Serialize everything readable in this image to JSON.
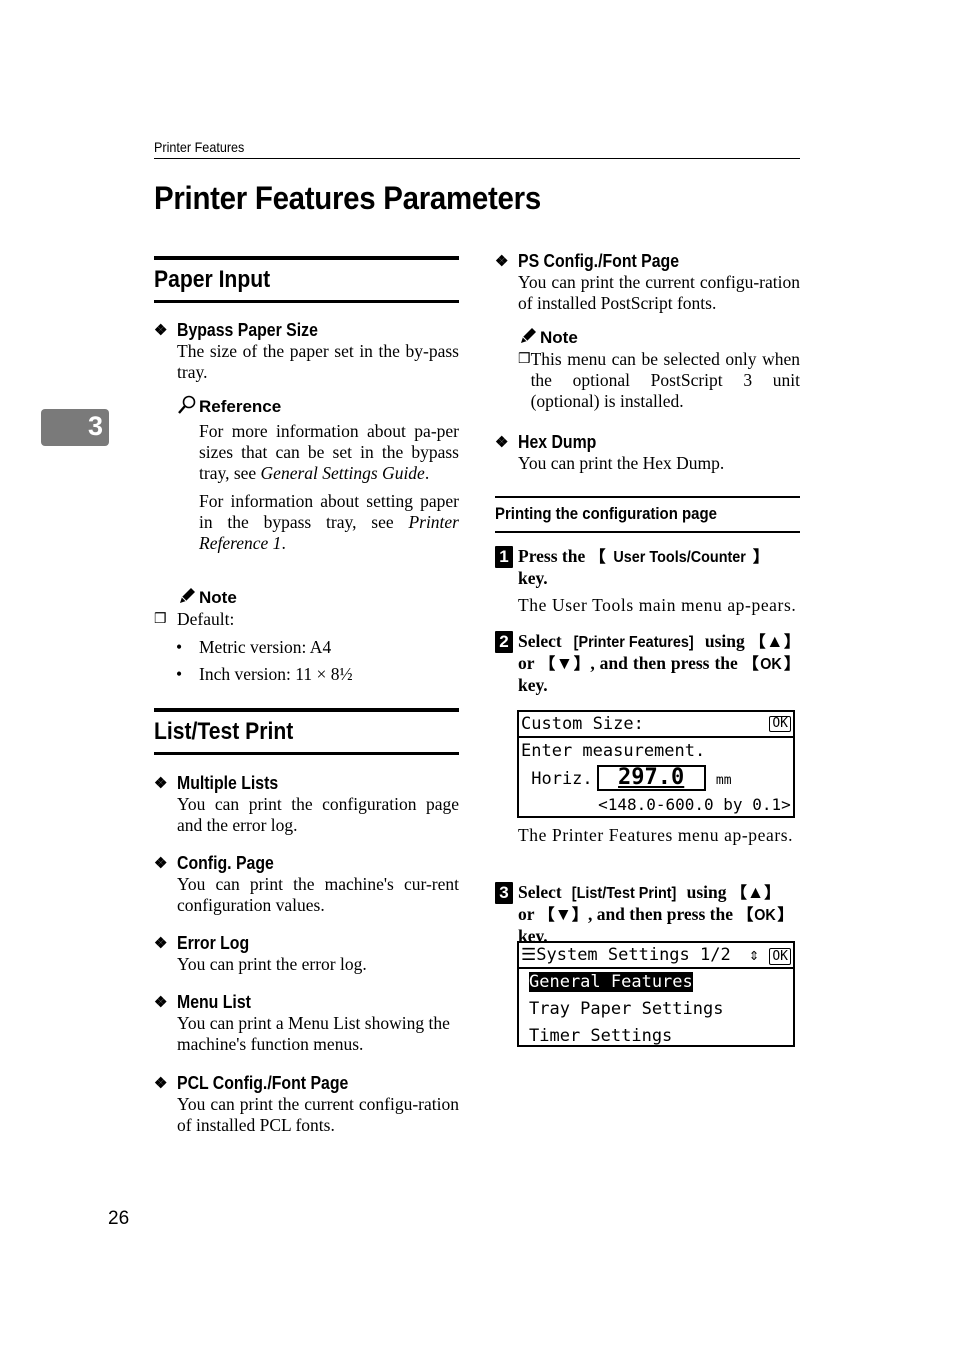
{
  "header": {
    "running_head": "Printer Features",
    "page_title": "Printer Features Parameters",
    "chapter_tab": "3"
  },
  "left": {
    "paper_input": {
      "heading": "Paper Input",
      "items": [
        {
          "title": "Bypass Paper Size",
          "body": "The size of the paper set in the by-pass tray."
        }
      ],
      "reference": {
        "label": "Reference",
        "icon": "magnifier-icon",
        "paragraph1_pre": "For more information about pa-per sizes that can be set in the bypass tray, see ",
        "paragraph1_italic": "General Settings Guide",
        "paragraph1_post": ".",
        "paragraph2_pre": "For information about setting paper in the bypass tray, see ",
        "paragraph2_italic": "Printer Reference 1",
        "paragraph2_post": "."
      },
      "note": {
        "label": "Note",
        "icon": "pencil-icon",
        "check_item": "Default:",
        "bullets": [
          "Metric version: A4",
          "Inch version: 11 × 8½"
        ]
      }
    },
    "list_test_print": {
      "heading": "List/Test Print",
      "items": [
        {
          "title": "Multiple Lists",
          "body": "You can print the configuration page and the error log."
        },
        {
          "title": "Config. Page",
          "body": "You can print the machine's cur-rent configuration values."
        },
        {
          "title": "Error Log",
          "body": "You can print the error log."
        },
        {
          "title": "Menu List",
          "body": "You can print a Menu List showing the machine's function menus."
        },
        {
          "title": "PCL Config./Font Page",
          "body": "You can print the current configu-ration of installed PCL fonts."
        }
      ]
    }
  },
  "right": {
    "ps_config": {
      "title": "PS Config./Font Page",
      "body": "You can print the current configu-ration of installed PostScript fonts.",
      "note_label": "Note",
      "note_text": "This menu can be selected only when the optional PostScript 3 unit (optional) is installed."
    },
    "hex_dump": {
      "title": "Hex Dump",
      "body": "You can print the Hex Dump."
    },
    "procedure": {
      "heading": "Printing the configuration page",
      "steps": [
        {
          "number": "1",
          "pre": "Press the ",
          "key": "User Tools/Counter",
          "post": " key.",
          "desc": "The User Tools main menu ap-pears."
        },
        {
          "number": "2",
          "pre": "Select ",
          "menu": "[Printer Features]",
          "mid1": " using ",
          "key_up": "▲",
          "mid2": " or ",
          "key_down": "▼",
          "mid3": ", and then press the ",
          "key_ok": "OK",
          "post": " key.",
          "desc": "The Printer Features menu ap-pears."
        },
        {
          "number": "3",
          "pre": "Select ",
          "menu": "[List/Test Print]",
          "mid1": " using ",
          "key_up": "▲",
          "mid2": " or ",
          "key_down": "▼",
          "mid3": ", and then press the ",
          "key_ok": "OK",
          "post": " key."
        }
      ]
    },
    "lcd1": {
      "title": "Custom Size:",
      "ok": "OK",
      "line1": "Enter measurement.",
      "label": " Horiz.",
      "value": "297.0",
      "unit": "mm",
      "range": "        <148.0-600.0 by 0.1>"
    },
    "lcd2": {
      "title": "System Settings 1/2",
      "scroll_icon": "⇕",
      "ok": "OK",
      "items": [
        "General Features",
        "Tray Paper Settings",
        "Timer Settings"
      ],
      "selected_index": 0
    }
  },
  "footer": {
    "page_number": "26"
  }
}
